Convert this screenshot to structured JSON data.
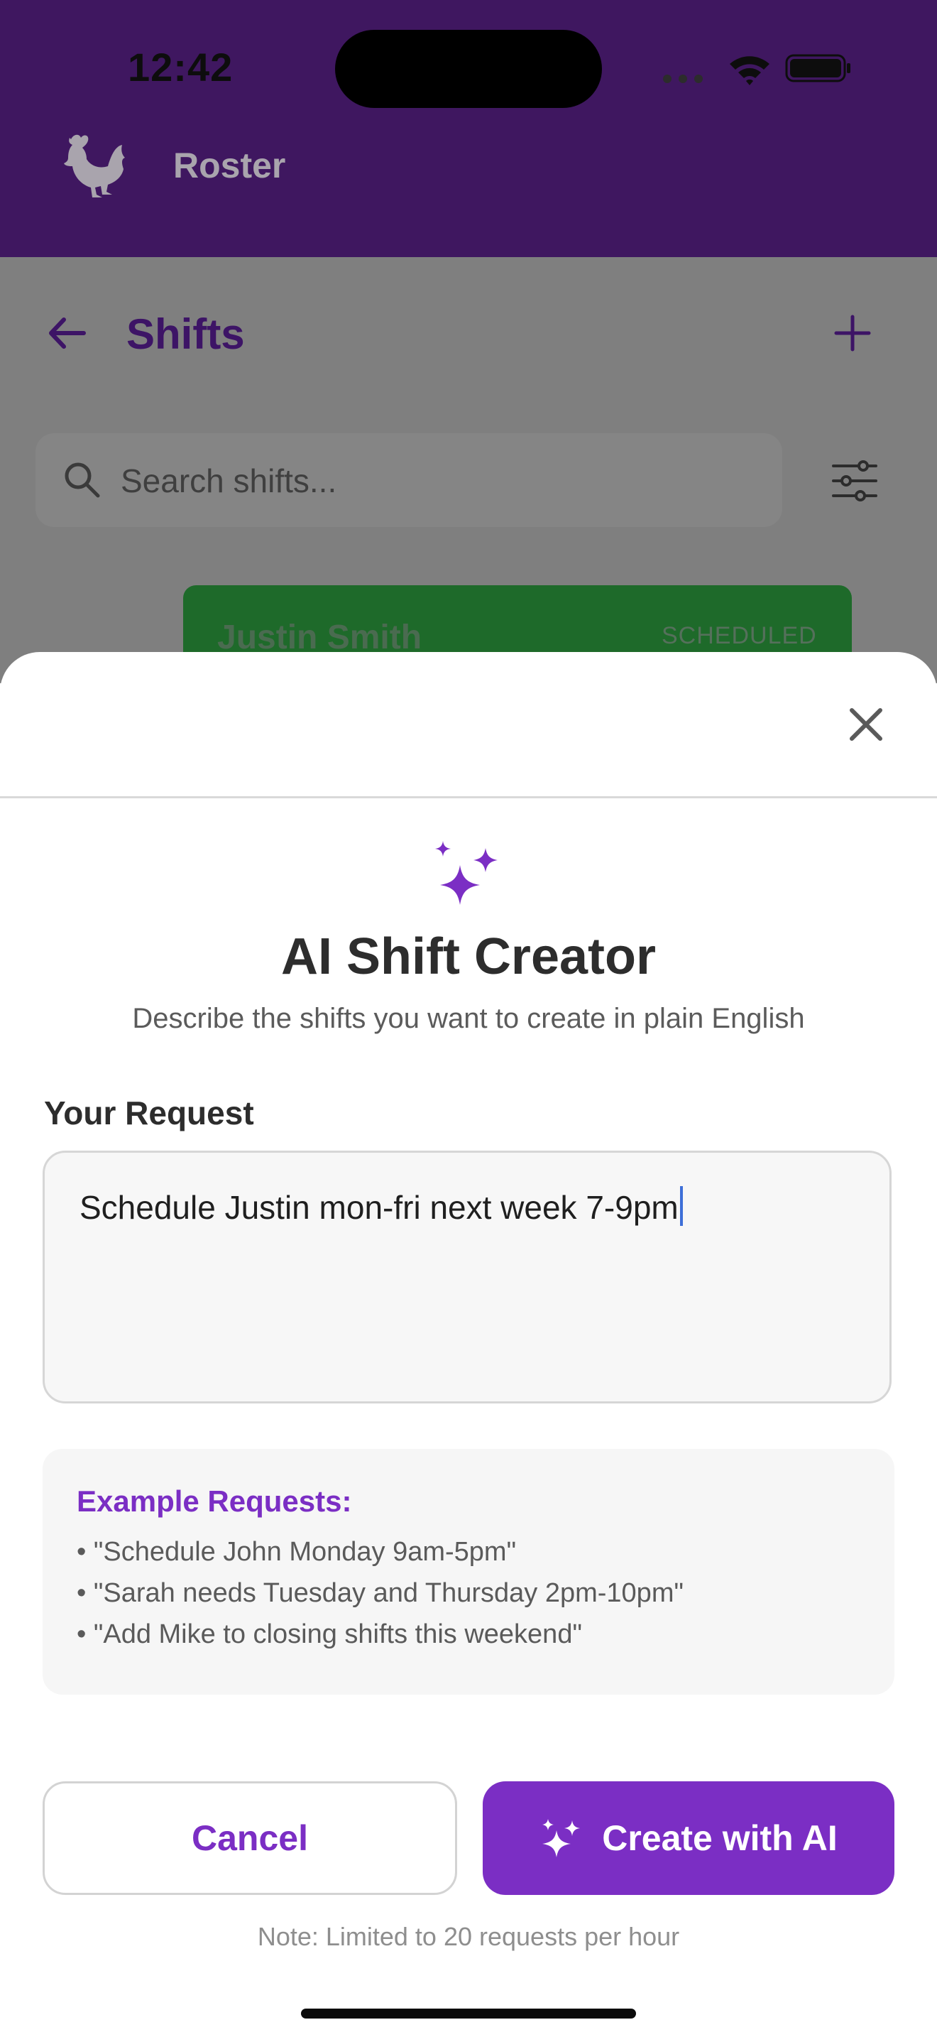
{
  "status_bar": {
    "time": "12:42"
  },
  "app": {
    "title": "Roster"
  },
  "page": {
    "title": "Shifts"
  },
  "search": {
    "placeholder": "Search shifts..."
  },
  "shift_card": {
    "name": "Justin Smith",
    "status": "SCHEDULED"
  },
  "modal": {
    "title": "AI Shift Creator",
    "subtitle": "Describe the shifts you want to create in plain English",
    "field_label": "Your Request",
    "request_value": "Schedule Justin mon-fri next week 7-9pm",
    "examples_title": "Example Requests:",
    "examples": [
      "• \"Schedule John Monday 9am-5pm\"",
      "• \"Sarah needs Tuesday and Thursday 2pm-10pm\"",
      "• \"Add Mike to closing shifts this weekend\""
    ],
    "cancel_label": "Cancel",
    "create_label": "Create with AI",
    "note": "Note: Limited to 20 requests per hour"
  },
  "colors": {
    "header": "#3f1760",
    "accent": "#7b2ec4",
    "shift_card": "#1e6a2a",
    "overlay": "#7f7f7f"
  },
  "icons": [
    "rooster-logo-icon",
    "back-arrow-icon",
    "plus-icon",
    "search-icon",
    "filter-sliders-icon",
    "close-icon",
    "sparkles-icon",
    "wifi-icon",
    "battery-icon"
  ]
}
